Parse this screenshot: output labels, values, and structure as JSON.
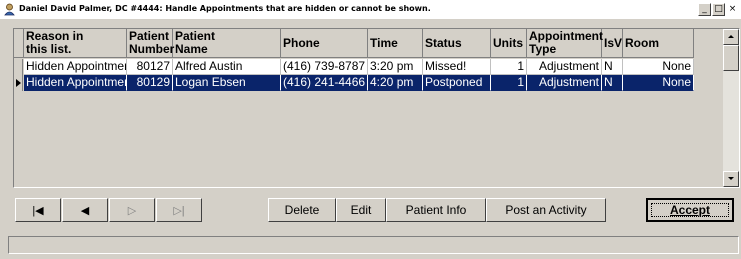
{
  "window": {
    "title": "Daniel David Palmer, DC #4444: Handle Appointments that are hidden or cannot be shown.",
    "controls": [
      "_",
      "□",
      "×"
    ]
  },
  "grid": {
    "columns": [
      {
        "label": "Reason in\nthis list."
      },
      {
        "label": "Patient\nNumber"
      },
      {
        "label": "Patient\nName"
      },
      {
        "label": "Phone"
      },
      {
        "label": "Time"
      },
      {
        "label": "Status"
      },
      {
        "label": "Units"
      },
      {
        "label": "Appointment\nType"
      },
      {
        "label": "IsV"
      },
      {
        "label": "Room"
      }
    ],
    "rows": [
      {
        "reason": "Hidden Appointmen",
        "number": "80127",
        "name": "Alfred Austin",
        "phone": "(416) 739-8787",
        "time": "3:20 pm",
        "status": "Missed!",
        "units": "1",
        "type": "Adjustment",
        "isv": "N",
        "room": "None",
        "selected": false
      },
      {
        "reason": "Hidden Appointmen",
        "number": "80129",
        "name": "Logan Ebsen",
        "phone": "(416) 241-4466",
        "time": "4:20 pm",
        "status": "Postponed",
        "units": "1",
        "type": "Adjustment",
        "isv": "N",
        "room": "None",
        "selected": true
      }
    ]
  },
  "navigator": {
    "first": "|◀",
    "prior": "◀",
    "next": "▷",
    "last": "▷|"
  },
  "actions": {
    "delete": "Delete",
    "edit": "Edit",
    "patient_info": "Patient Info",
    "post_activity": "Post an Activity",
    "accept": "Accept"
  },
  "status_bar": ""
}
